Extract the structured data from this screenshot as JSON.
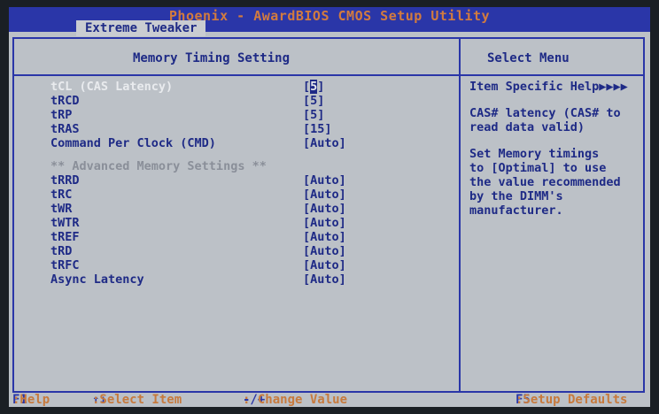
{
  "title": "Phoenix - AwardBIOS CMOS Setup Utility",
  "tab": "Extreme Tweaker",
  "left_header": "Memory Timing Setting",
  "right_header": "Select Menu",
  "settings": [
    {
      "label": "tCL (CAS Latency)",
      "value_pre": "[",
      "value_cursor": "5",
      "value_post": "]"
    },
    {
      "label": "tRCD",
      "value": "[5]"
    },
    {
      "label": "tRP",
      "value": "[5]"
    },
    {
      "label": "tRAS",
      "value": "[15]"
    },
    {
      "label": "Command Per Clock (CMD)",
      "value": "[Auto]"
    }
  ],
  "advanced_header": "** Advanced Memory Settings **",
  "advanced": [
    {
      "label": "tRRD",
      "value": "[Auto]"
    },
    {
      "label": "tRC",
      "value": "[Auto]"
    },
    {
      "label": "tWR",
      "value": "[Auto]"
    },
    {
      "label": "tWTR",
      "value": "[Auto]"
    },
    {
      "label": "tREF",
      "value": "[Auto]"
    },
    {
      "label": "tRD",
      "value": "[Auto]"
    },
    {
      "label": "tRFC",
      "value": "[Auto]"
    },
    {
      "label": "Async Latency",
      "value": "[Auto]"
    }
  ],
  "help": {
    "heading": "Item Specific Help▶▶▶▶",
    "line1": "CAS# latency (CAS# to",
    "line2": "read data valid)",
    "line3": "Set Memory timings",
    "line4": "to [Optimal] to use",
    "line5": "the value recommended",
    "line6": "by the DIMM's",
    "line7": "manufacturer."
  },
  "footer": {
    "f1_key": "F1",
    "f1_label": ":Help",
    "arrows_key": "↑↓",
    "arrows_label": ":Select Item",
    "pm_key": "-/+",
    "pm_label": ": Change Value",
    "f5_key": "F5",
    "f5_label": ":Setup Defaults"
  },
  "colors": {
    "bios_blue": "#2a36a8",
    "bios_gray": "#bcc1c7",
    "title_orange": "#d27b3f"
  }
}
